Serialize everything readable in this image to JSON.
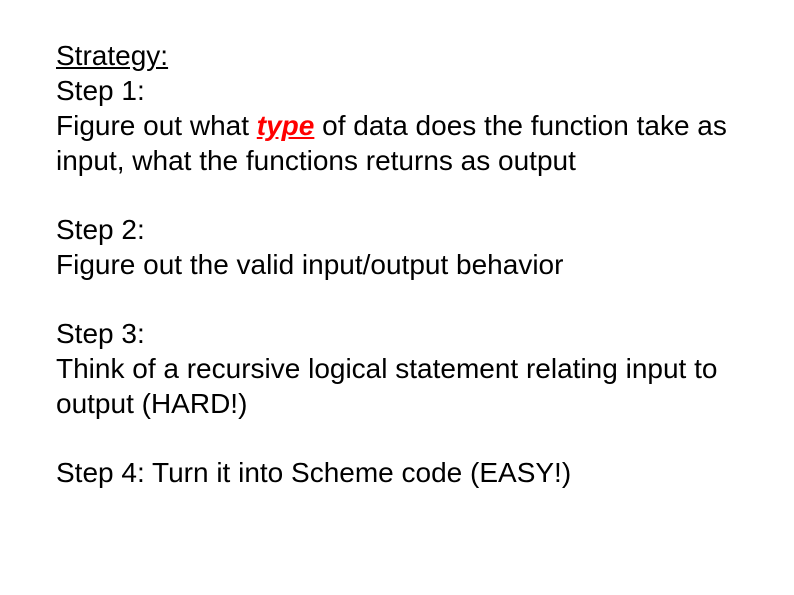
{
  "strategy_label": "Strategy:",
  "step1": {
    "heading": "Step 1:",
    "line_prefix": "Figure out what ",
    "type_word": "type",
    "line_suffix": " of data does the function take as input, what the functions returns as output"
  },
  "step2": {
    "heading": "Step 2:",
    "body": "Figure out the valid input/output behavior"
  },
  "step3": {
    "heading": "Step 3:",
    "body": "Think of a recursive logical statement relating input to output (HARD!)"
  },
  "step4": {
    "line": "Step 4: Turn it into Scheme code (EASY!)"
  }
}
